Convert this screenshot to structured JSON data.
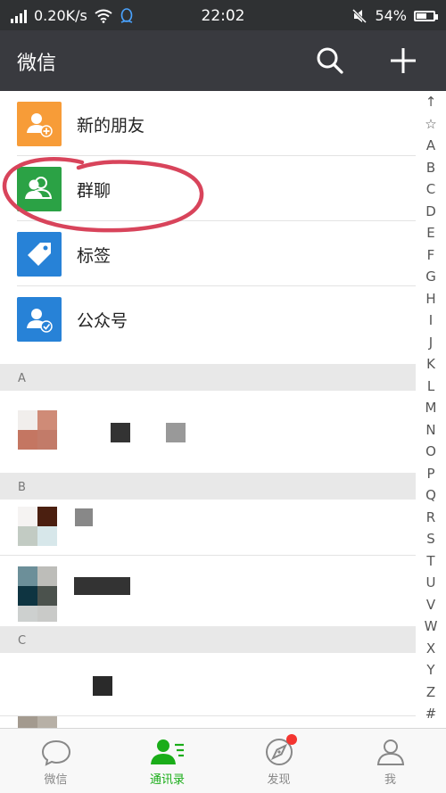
{
  "status_bar": {
    "speed": "0.20K/s",
    "time": "22:02",
    "battery": "54%"
  },
  "header": {
    "title": "微信",
    "search_icon": "search-icon",
    "add_icon": "plus-icon"
  },
  "functions": [
    {
      "label": "新的朋友",
      "icon": "new-friend-icon",
      "color": "#f79c38"
    },
    {
      "label": "群聊",
      "icon": "group-chat-icon",
      "color": "#2ba245"
    },
    {
      "label": "标签",
      "icon": "tag-icon",
      "color": "#2782d7"
    },
    {
      "label": "公众号",
      "icon": "official-account-icon",
      "color": "#2782d7"
    }
  ],
  "sections": [
    "A",
    "B",
    "C"
  ],
  "index_letters": [
    "↑",
    "☆",
    "A",
    "B",
    "C",
    "D",
    "E",
    "F",
    "G",
    "H",
    "I",
    "J",
    "K",
    "L",
    "M",
    "N",
    "O",
    "P",
    "Q",
    "R",
    "S",
    "T",
    "U",
    "V",
    "W",
    "X",
    "Y",
    "Z",
    "#"
  ],
  "tabs": [
    {
      "label": "微信",
      "icon": "chat-bubble-icon",
      "active": false
    },
    {
      "label": "通讯录",
      "icon": "contacts-icon",
      "active": true
    },
    {
      "label": "发现",
      "icon": "compass-icon",
      "active": false,
      "badge": true
    },
    {
      "label": "我",
      "icon": "person-icon",
      "active": false
    }
  ],
  "colors": {
    "accent": "#1aad19",
    "header": "#393a3f",
    "annotation": "#d8445b"
  }
}
